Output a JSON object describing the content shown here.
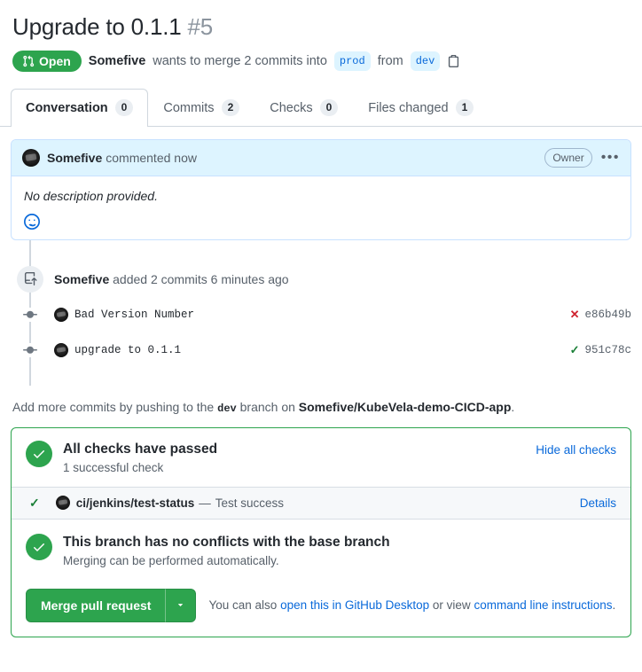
{
  "header": {
    "title": "Upgrade to 0.1.1",
    "number": "#5",
    "state_label": "Open",
    "state_icon": "git-pull-request-icon",
    "state_color": "#2da44e",
    "author": "Somefive",
    "merge_text_1": "wants to merge 2 commits into",
    "base_branch": "prod",
    "merge_text_2": "from",
    "head_branch": "dev",
    "copy_icon": "copy-icon"
  },
  "tabs": [
    {
      "label": "Conversation",
      "count": "0",
      "active": true
    },
    {
      "label": "Commits",
      "count": "2",
      "active": false
    },
    {
      "label": "Checks",
      "count": "0",
      "active": false
    },
    {
      "label": "Files changed",
      "count": "1",
      "active": false
    }
  ],
  "comment": {
    "author": "Somefive",
    "action": "commented now",
    "role_badge": "Owner",
    "menu_icon": "kebab-horizontal-icon",
    "body": "No description provided.",
    "reaction_icon": "smiley-icon"
  },
  "timeline": {
    "event_icon": "repo-push-icon",
    "event_author": "Somefive",
    "event_text": "added 2 commits 6 minutes ago",
    "commits": [
      {
        "message": "Bad Version Number",
        "status": "failure",
        "status_icon": "x-icon",
        "sha": "e86b49b"
      },
      {
        "message": "upgrade to 0.1.1",
        "status": "success",
        "status_icon": "check-icon",
        "sha": "951c78c"
      }
    ],
    "push_note_1": "Add more commits by pushing to the",
    "push_note_branch": "dev",
    "push_note_2": "branch on",
    "push_note_repo": "Somefive/KubeVela-demo-CICD-app",
    "push_note_3": "."
  },
  "merge_box": {
    "border_color": "#2da44e",
    "checks": {
      "icon": "check-circle-icon",
      "title": "All checks have passed",
      "subtitle": "1 successful check",
      "toggle_link": "Hide all checks"
    },
    "check_rows": [
      {
        "status_icon": "check-icon",
        "name": "ci/jenkins/test-status",
        "separator": "—",
        "description": "Test success",
        "details_link": "Details"
      }
    ],
    "conflicts": {
      "icon": "check-circle-icon",
      "title": "This branch has no conflicts with the base branch",
      "subtitle": "Merging can be performed automatically."
    },
    "actions": {
      "merge_button": "Merge pull request",
      "dropdown_icon": "triangle-down-icon",
      "also_prefix": "You can also",
      "desktop_link": "open this in GitHub Desktop",
      "also_middle": "or view",
      "cli_link": "command line instructions",
      "also_suffix": "."
    }
  }
}
